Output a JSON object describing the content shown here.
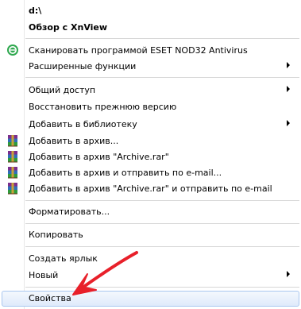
{
  "menu": {
    "items": [
      {
        "name": "drive-label",
        "label": "d:\\",
        "bold": true
      },
      {
        "name": "browse-with-xnview",
        "label": "Обзор с XnView",
        "bold": true
      },
      {
        "name": "eset-scan",
        "label": "Сканировать программой ESET NOD32 Antivirus",
        "icon": "eset-icon"
      },
      {
        "name": "advanced-functions",
        "label": "Расширенные функции",
        "submenu": true
      },
      {
        "name": "share-with",
        "label": "Общий доступ",
        "submenu": true
      },
      {
        "name": "restore-previous-version",
        "label": "Восстановить прежнюю версию"
      },
      {
        "name": "include-in-library",
        "label": "Добавить в библиотеку",
        "submenu": true
      },
      {
        "name": "add-to-archive",
        "label": "Добавить в архив...",
        "icon": "winrar-icon"
      },
      {
        "name": "add-to-archive-rar",
        "label": "Добавить в архив \"Archive.rar\"",
        "icon": "winrar-icon"
      },
      {
        "name": "add-to-archive-and-email",
        "label": "Добавить в архив и отправить по e-mail...",
        "icon": "winrar-icon"
      },
      {
        "name": "add-to-archive-rar-and-email",
        "label": "Добавить в архив \"Archive.rar\" и отправить по e-mail",
        "icon": "winrar-icon"
      },
      {
        "name": "format",
        "label": "Форматировать..."
      },
      {
        "name": "copy",
        "label": "Копировать"
      },
      {
        "name": "create-shortcut",
        "label": "Создать ярлык"
      },
      {
        "name": "new",
        "label": "Новый",
        "submenu": true
      },
      {
        "name": "properties",
        "label": "Свойства",
        "highlighted": true
      }
    ]
  },
  "annotation": {
    "arrow_color": "#e8202a"
  }
}
